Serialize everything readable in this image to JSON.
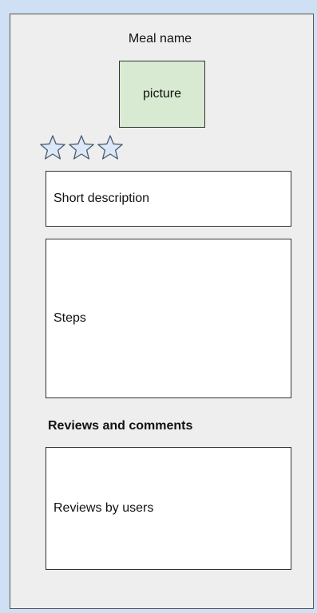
{
  "meal": {
    "name": "Meal name",
    "picture_label": "picture",
    "rating": {
      "stars_total": 3,
      "stars_filled": 0
    }
  },
  "short_description": {
    "label": "Short description"
  },
  "steps": {
    "label": "Steps"
  },
  "reviews": {
    "heading": "Reviews and comments",
    "label": "Reviews by users"
  },
  "colors": {
    "page_background": "#cfe0f5",
    "panel_background": "#eeeeee",
    "picture_fill": "#d9ead3",
    "star_fill": "#dce8f7",
    "star_stroke": "#4a5a70"
  }
}
